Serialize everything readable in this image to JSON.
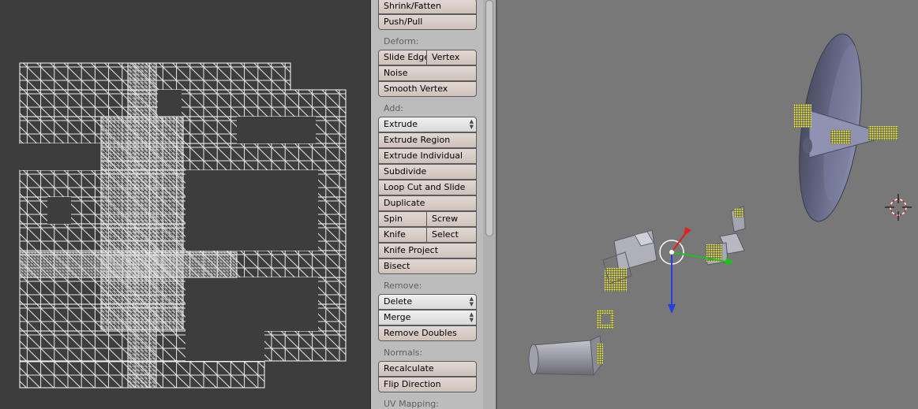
{
  "tool_shelf": {
    "transform": {
      "shrink_fatten": "Shrink/Fatten",
      "push_pull": "Push/Pull"
    },
    "deform": {
      "label": "Deform:",
      "slide_edge": "Slide Edge",
      "vertex": "Vertex",
      "noise": "Noise",
      "smooth_vertex": "Smooth Vertex"
    },
    "add": {
      "label": "Add:",
      "extrude": "Extrude",
      "extrude_region": "Extrude Region",
      "extrude_individual": "Extrude Individual",
      "subdivide": "Subdivide",
      "loop_cut_and_slide": "Loop Cut and Slide",
      "duplicate": "Duplicate",
      "spin": "Spin",
      "screw": "Screw",
      "knife": "Knife",
      "select": "Select",
      "knife_project": "Knife Project",
      "bisect": "Bisect"
    },
    "remove": {
      "label": "Remove:",
      "delete": "Delete",
      "merge": "Merge",
      "remove_doubles": "Remove Doubles"
    },
    "normals": {
      "label": "Normals:",
      "recalculate": "Recalculate",
      "flip_direction": "Flip Direction"
    },
    "uv_mapping": {
      "label": "UV Mapping:"
    }
  },
  "icons": {
    "dropdown": "updown-arrows-icon",
    "cursor": "3d-cursor-icon",
    "manipulator": "transform-manipulator-icon"
  },
  "colors": {
    "uv_background": "#3d3d3d",
    "uv_wire": "#e8e8e8",
    "shelf_background": "#bcbcbc",
    "viewport_background": "#787878",
    "selected_vertex": "#ffff55",
    "axis_x": "#e02020",
    "axis_y": "#20c020",
    "axis_z": "#2040e0"
  }
}
